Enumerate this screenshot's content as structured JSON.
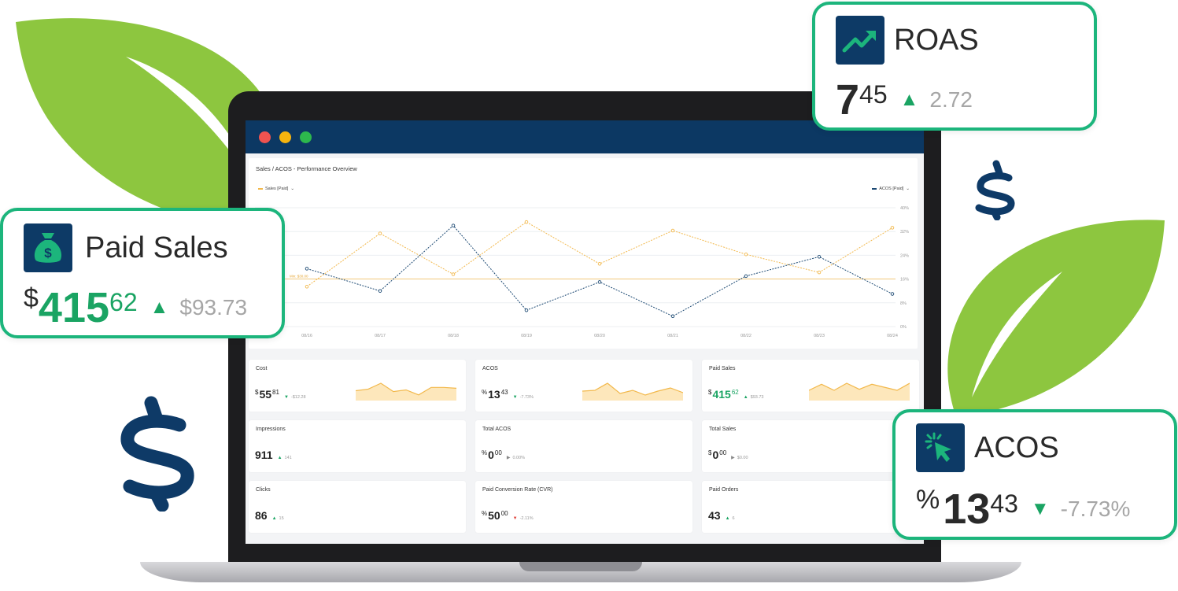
{
  "colors": {
    "accent_green": "#1cb57c",
    "navy": "#0c3863",
    "leaf_green": "#8dc63f",
    "sales_line": "#f2b84b",
    "acos_line": "#1b4872"
  },
  "window": {
    "controls": [
      "close",
      "minimize",
      "maximize"
    ]
  },
  "chart": {
    "title": "Sales / ACOS - Performance Overview",
    "legend_left": "Sales [Paid]",
    "legend_right": "ACOS [Paid]",
    "threshold_label": "Min: $30.00"
  },
  "chart_data": {
    "type": "line",
    "title": "Sales / ACOS - Performance Overview",
    "categories": [
      "08/16",
      "08/17",
      "08/18",
      "08/19",
      "08/20",
      "08/21",
      "08/22",
      "08/23",
      "08/24"
    ],
    "series": [
      {
        "name": "Sales [Paid]",
        "axis": "left",
        "values": [
          42,
          98,
          55,
          110,
          66,
          101,
          76,
          57,
          104
        ]
      },
      {
        "name": "ACOS [Paid]",
        "axis": "right",
        "values": [
          19.5,
          12,
          34,
          5.5,
          15,
          3.5,
          17,
          23.5,
          11
        ]
      }
    ],
    "reference_line": {
      "label": "Min: $30.00",
      "value": 50
    },
    "y_right_ticks": [
      "40%",
      "32%",
      "24%",
      "16%",
      "8%",
      "0%"
    ],
    "y_right_lim": [
      0,
      40
    ],
    "y_left_lim": [
      0,
      125
    ],
    "grid": true
  },
  "kpis": [
    {
      "label": "Cost",
      "prefix": "$",
      "int": "55",
      "dec": "81",
      "trend": "down",
      "trend_color": "green",
      "change": "-$12.28",
      "spark": [
        8,
        10,
        17,
        7,
        9,
        3,
        12,
        12,
        11
      ]
    },
    {
      "label": "ACOS",
      "prefix": "%",
      "int": "13",
      "dec": "43",
      "trend": "down",
      "trend_color": "green",
      "change": "-7.73%",
      "spark": [
        8,
        9,
        18,
        5,
        9,
        3,
        8,
        12,
        6
      ]
    },
    {
      "label": "Paid Sales",
      "prefix": "$",
      "int": "415",
      "dec": "62",
      "int_color": "green",
      "trend": "up",
      "trend_color": "green",
      "change": "$93.73",
      "spark": [
        7,
        13,
        7,
        14,
        8,
        13,
        10,
        7,
        14
      ]
    },
    {
      "label": "Impressions",
      "prefix": "",
      "int": "911",
      "dec": "",
      "trend": "up",
      "trend_color": "green",
      "change": "141"
    },
    {
      "label": "Total ACOS",
      "prefix": "%",
      "int": "0",
      "dec": "00",
      "trend": "flat",
      "trend_color": "grey",
      "change": "0.00%"
    },
    {
      "label": "Total Sales",
      "prefix": "$",
      "int": "0",
      "dec": "00",
      "trend": "flat",
      "trend_color": "grey",
      "change": "$0.00"
    },
    {
      "label": "Clicks",
      "prefix": "",
      "int": "86",
      "dec": "",
      "trend": "up",
      "trend_color": "green",
      "change": "15"
    },
    {
      "label": "Paid Conversion Rate (CVR)",
      "prefix": "%",
      "int": "50",
      "dec": "00",
      "trend": "down",
      "trend_color": "red",
      "change": "-2.11%"
    },
    {
      "label": "Paid Orders",
      "prefix": "",
      "int": "43",
      "dec": "",
      "trend": "up",
      "trend_color": "green",
      "change": "6"
    }
  ],
  "cards": {
    "roas": {
      "title": "ROAS",
      "int": "7",
      "dec": "45",
      "trend": "up",
      "change": "2.72",
      "icon": "trending-up-icon"
    },
    "paid_sales": {
      "title": "Paid Sales",
      "prefix": "$",
      "int": "415",
      "dec": "62",
      "trend": "up",
      "change": "$93.73",
      "icon": "money-bag-icon"
    },
    "acos": {
      "title": "ACOS",
      "prefix": "%",
      "int": "13",
      "dec": "43",
      "trend": "down",
      "change": "-7.73%",
      "icon": "cursor-click-icon"
    }
  }
}
